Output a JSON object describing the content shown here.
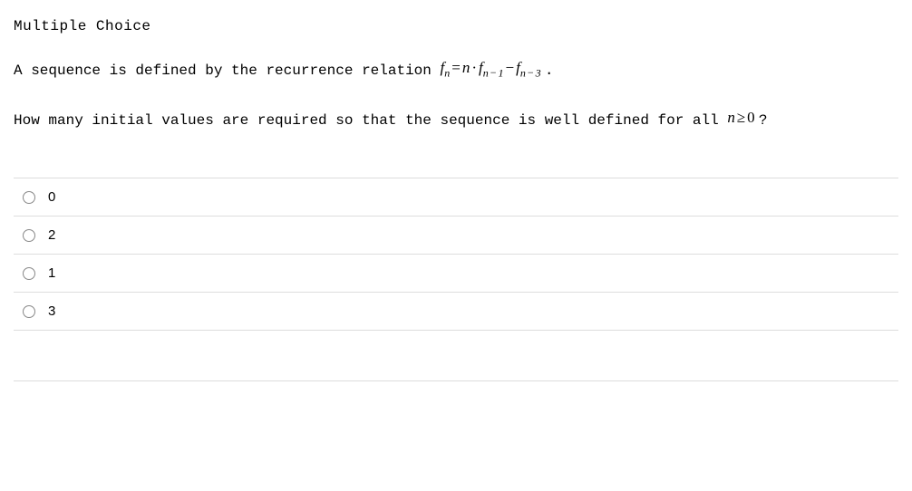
{
  "question_type": "Multiple Choice",
  "prompt_part1": "A sequence is defined by the recurrence relation ",
  "prompt_part2_period": ".",
  "detail_part1": "How many initial values are required so that the sequence is well defined for all ",
  "detail_part2": "?",
  "formula": {
    "f": "f",
    "n": "n",
    "eq": "=",
    "dot": "·",
    "minus": "−",
    "one": "1",
    "three": "3"
  },
  "cond": {
    "n": "n",
    "ge": "≥",
    "zero": "0"
  },
  "options": [
    {
      "label": "0"
    },
    {
      "label": "2"
    },
    {
      "label": "1"
    },
    {
      "label": "3"
    }
  ]
}
